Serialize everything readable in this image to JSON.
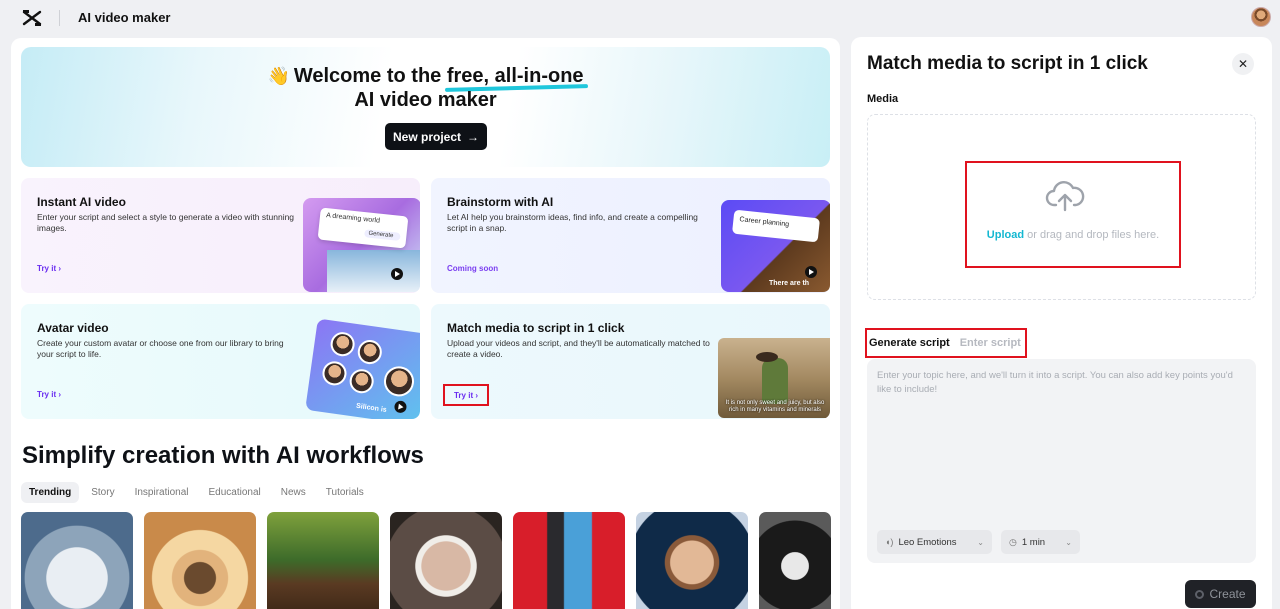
{
  "app": {
    "title": "AI video maker"
  },
  "hero": {
    "line1_prefix": "Welcome to the",
    "line1_highlight": "free, all-in-one",
    "line2": "AI video maker",
    "wave_icon": "👋",
    "new_project_label": "New project"
  },
  "cards": [
    {
      "title": "Instant AI video",
      "desc": "Enter your script and select a style to generate a video with stunning images.",
      "action": "Try it",
      "thumb_text": "A dreaming world",
      "thumb_button": "Generate"
    },
    {
      "title": "Brainstorm with AI",
      "desc": "Let AI help you brainstorm ideas, find info, and create a compelling script in a snap.",
      "action": "Coming soon",
      "thumb_text": "Career planning",
      "thumb_caption": "There are th"
    },
    {
      "title": "Avatar video",
      "desc": "Create your custom avatar or choose one from our library to bring your script to life.",
      "action": "Try it",
      "thumb_caption": "Silicon is"
    },
    {
      "title": "Match media to script in 1 click",
      "desc": "Upload your videos and script, and they'll be automatically matched to create a video.",
      "action": "Try it",
      "thumb_caption": "It is not only sweet and juicy, but also rich in many vitamins and minerals"
    }
  ],
  "workflows": {
    "title": "Simplify creation with AI workflows",
    "tabs": [
      "Trending",
      "Story",
      "Inspirational",
      "Educational",
      "News",
      "Tutorials"
    ],
    "active_tab": "Trending"
  },
  "panel": {
    "title": "Match media to script in 1 click",
    "close_icon": "✕",
    "media_label": "Media",
    "upload_link": "Upload",
    "upload_rest": "or drag and drop files here.",
    "script_tabs": [
      "Generate script",
      "Enter script"
    ],
    "script_placeholder": "Enter your topic here, and we'll turn it into a script. You can also add key points you'd like to include!",
    "voice": "Leo Emotions",
    "duration": "1 min",
    "create_label": "Create"
  },
  "colors": {
    "accent": "#14b8d1",
    "highlight": "#e0121e",
    "try_link": "#6a2df0"
  }
}
